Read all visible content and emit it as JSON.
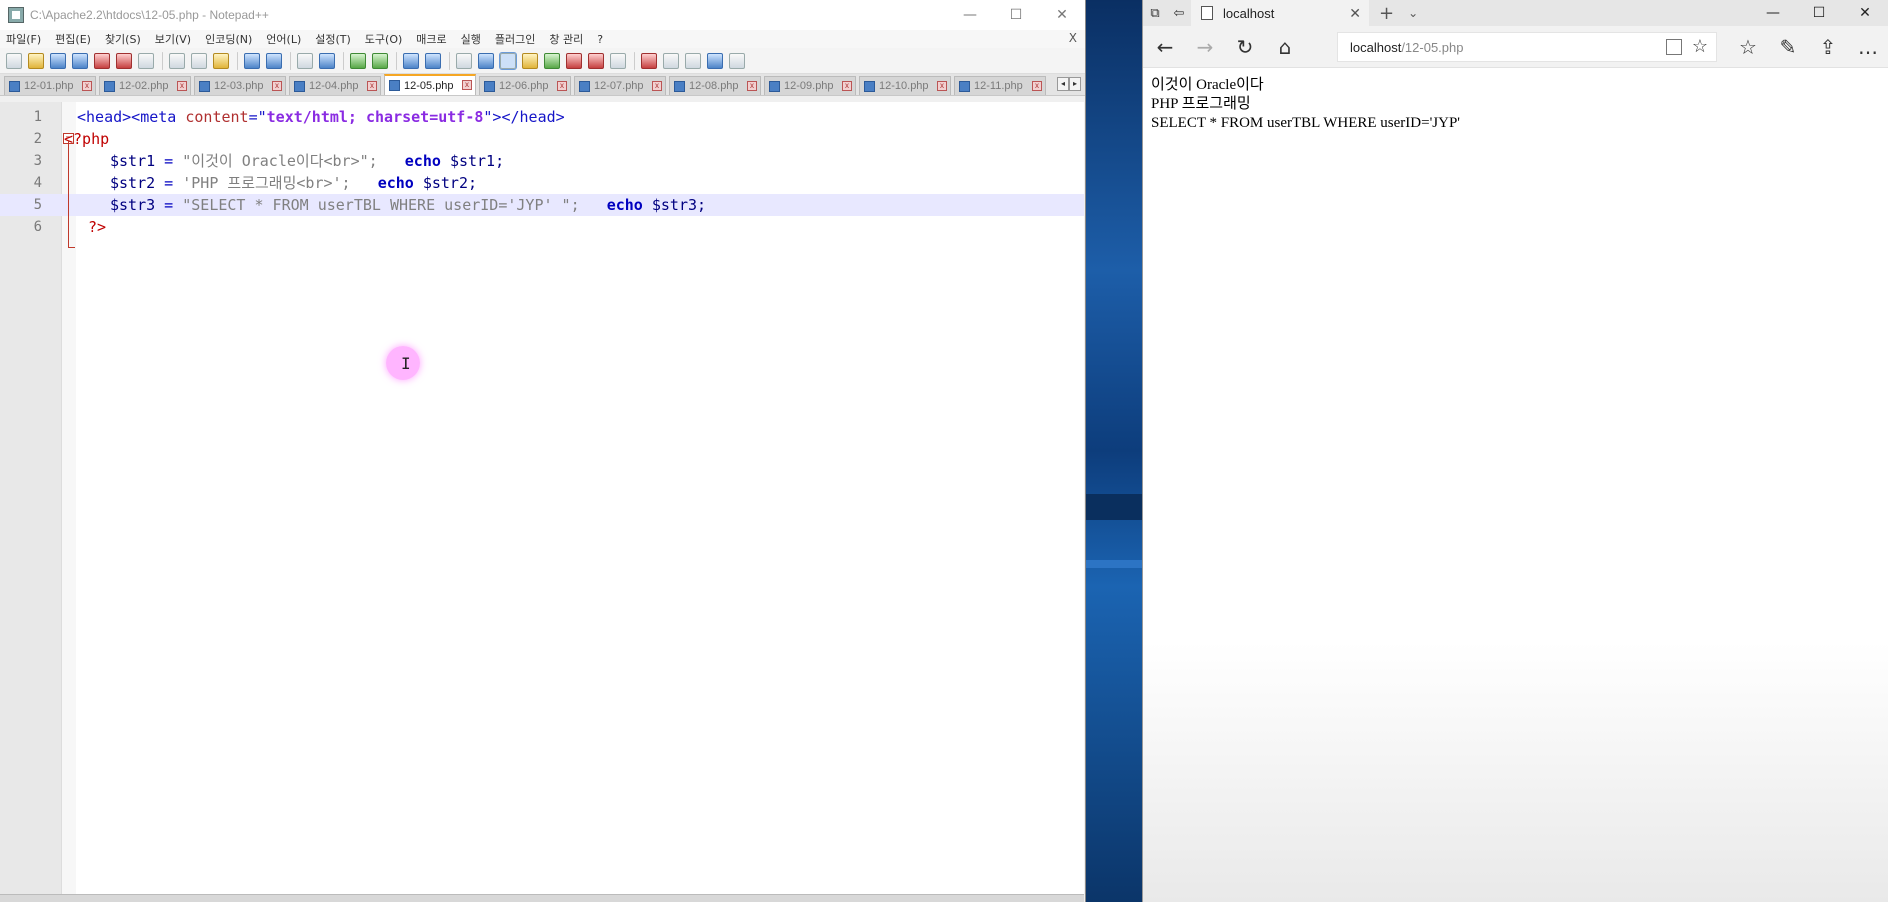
{
  "notepad": {
    "title": "C:\\Apache2.2\\htdocs\\12-05.php - Notepad++",
    "window_controls": {
      "minimize": "—",
      "maximize": "☐",
      "close": "✕"
    },
    "menu": [
      "파일(F)",
      "편집(E)",
      "찾기(S)",
      "보기(V)",
      "인코딩(N)",
      "언어(L)",
      "설정(T)",
      "도구(O)",
      "매크로",
      "실행",
      "플러그인",
      "창 관리",
      "?"
    ],
    "menu_close": "X",
    "tabs": [
      {
        "label": "12-01.php",
        "active": false
      },
      {
        "label": "12-02.php",
        "active": false
      },
      {
        "label": "12-03.php",
        "active": false
      },
      {
        "label": "12-04.php",
        "active": false
      },
      {
        "label": "12-05.php",
        "active": true
      },
      {
        "label": "12-06.php",
        "active": false
      },
      {
        "label": "12-07.php",
        "active": false
      },
      {
        "label": "12-08.php",
        "active": false
      },
      {
        "label": "12-09.php",
        "active": false
      },
      {
        "label": "12-10.php",
        "active": false
      },
      {
        "label": "12-11.php",
        "active": false
      }
    ],
    "tab_scroll": {
      "left": "◂",
      "right": "▸"
    },
    "code": {
      "line_numbers": [
        "1",
        "2",
        "3",
        "4",
        "5",
        "6"
      ],
      "l1": {
        "t1": "<head><meta ",
        "attr": "content",
        "eq": "=\"",
        "val": "text/html; charset=utf-8",
        "t2": "\"></head>"
      },
      "l2": {
        "t1": "<?php"
      },
      "l3": {
        "var": "$str1",
        "op": " = ",
        "str": "\"이것이 Oracle이다<br>\";",
        "kw": "echo",
        "var2": "$str1;"
      },
      "l4": {
        "var": "$str2",
        "op": " = ",
        "str": "'PHP 프로그래밍<br>';",
        "kw": "echo",
        "var2": "$str2;"
      },
      "l5": {
        "var": "$str3",
        "op": " = ",
        "str": "\"SELECT * FROM userTBL WHERE userID='JYP' \";",
        "kw": "echo",
        "var2": "$str3;"
      },
      "l6": {
        "t1": "?>"
      }
    },
    "cursor_glyph": "I"
  },
  "browser": {
    "tab_title": "localhost",
    "tab_close": "✕",
    "new_tab": "+",
    "tab_menu": "⌄",
    "address": {
      "host": "localhost",
      "path": "/12-05.php"
    },
    "nav": {
      "back": "←",
      "forward": "→",
      "refresh": "↻",
      "home": "⌂"
    },
    "right_icons": {
      "favorites": "☆",
      "pen": "✎",
      "share": "⇪",
      "more": "…"
    },
    "page_lines": [
      "이것이 Oracle이다",
      "PHP 프로그래밍",
      "SELECT * FROM userTBL WHERE userID='JYP'"
    ]
  }
}
